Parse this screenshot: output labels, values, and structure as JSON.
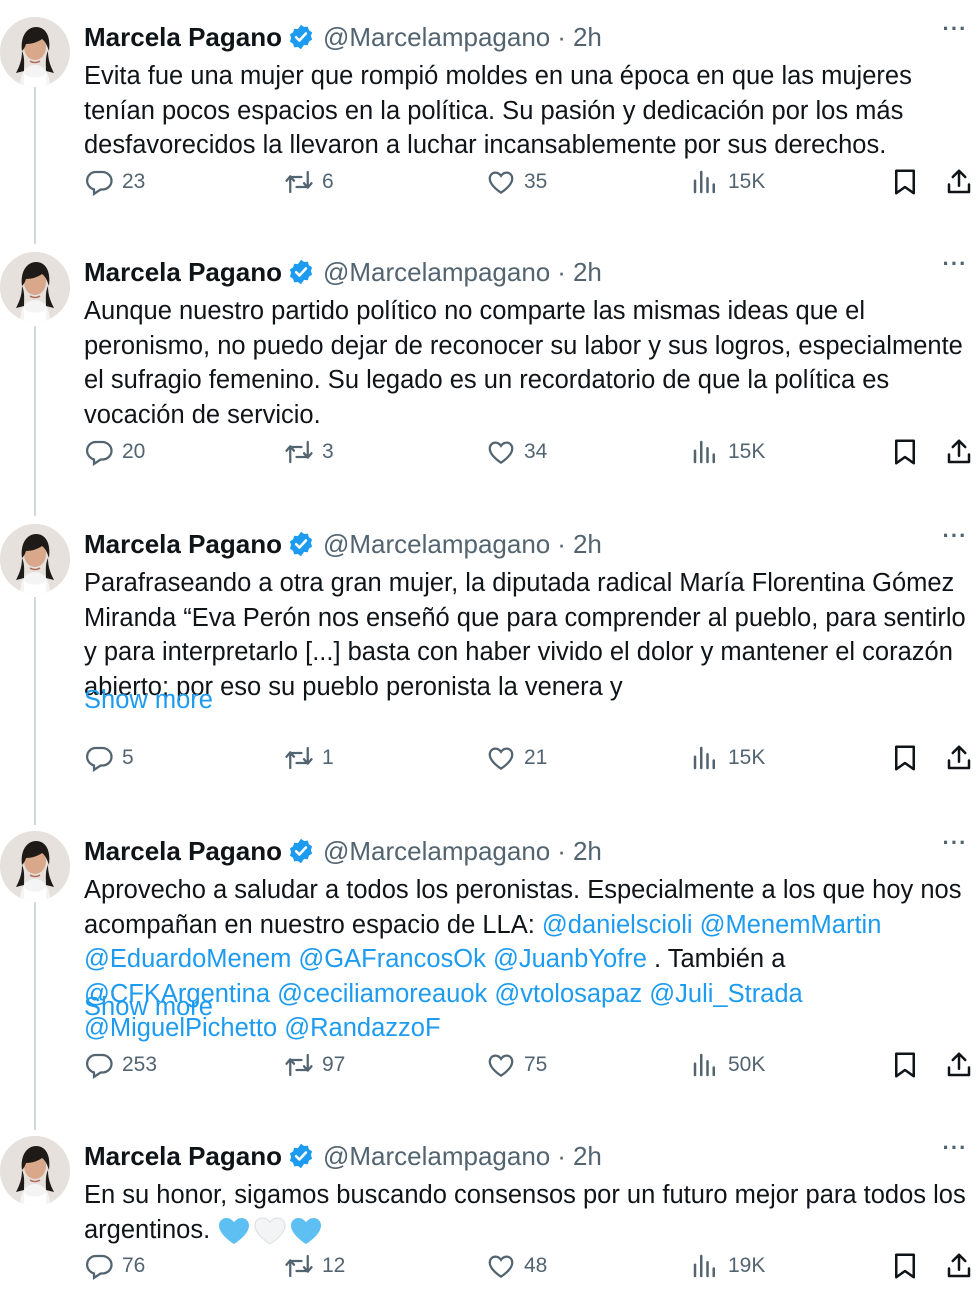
{
  "author": {
    "name": "Marcela Pagano",
    "handle": "@Marcelampagano",
    "time": "2h",
    "separator": "·",
    "more": "···"
  },
  "show_more_label": "Show more",
  "colors": {
    "accent": "#1d9bf0",
    "secondary_text": "#536471",
    "thread_line": "#cfd9de"
  },
  "icons": [
    "verified-badge-icon",
    "reply-icon",
    "retweet-icon",
    "like-icon",
    "views-icon",
    "bookmark-icon",
    "share-icon",
    "more-icon"
  ],
  "tweets": [
    {
      "text": "Evita fue una mujer que rompió moldes en una época en que las mujeres tenían pocos espacios en la política. Su pasión y dedicación por los más desfavorecidos la llevaron a luchar incansablemente por sus derechos.",
      "replies": "23",
      "retweets": "6",
      "likes": "35",
      "views": "15K"
    },
    {
      "text": "Aunque nuestro partido político no comparte las mismas ideas que el peronismo, no puedo dejar de reconocer su labor y sus logros, especialmente el sufragio femenino. Su legado es un recordatorio de que la política es vocación de servicio.",
      "replies": "20",
      "retweets": "3",
      "likes": "34",
      "views": "15K"
    },
    {
      "text": "Parafraseando a otra gran mujer, la diputada radical María Florentina Gómez Miranda “Eva Perón nos enseñó que para comprender al pueblo, para sentirlo y para interpretarlo [...] basta con haber vivido el dolor y mantener el corazón abierto; por eso su pueblo peronista la venera y",
      "replies": "5",
      "retweets": "1",
      "likes": "21",
      "views": "15K"
    },
    {
      "text_prefix": "Aprovecho a saludar a todos los peronistas. Especialmente a los que hoy nos acompañan en nuestro espacio de LLA: ",
      "mentions_a": [
        "@danielscioli",
        "@MenemMartin",
        "@EduardoMenem",
        "@GAFrancosOk",
        "@JuanbYofre"
      ],
      "text_mid": " . También a ",
      "mentions_b": [
        "@CFKArgentina",
        "@ceciliamoreauok",
        "@vtolosapaz",
        "@Juli_Strada",
        "@MiguelPichetto",
        "@RandazzoF"
      ],
      "replies": "253",
      "retweets": "97",
      "likes": "75",
      "views": "50K"
    },
    {
      "text": "En su honor, sigamos buscando consensos por un futuro mejor para todos los argentinos.",
      "emoji": [
        "blue-heart",
        "white-heart",
        "blue-heart"
      ],
      "replies": "76",
      "retweets": "12",
      "likes": "48",
      "views": "19K"
    }
  ]
}
